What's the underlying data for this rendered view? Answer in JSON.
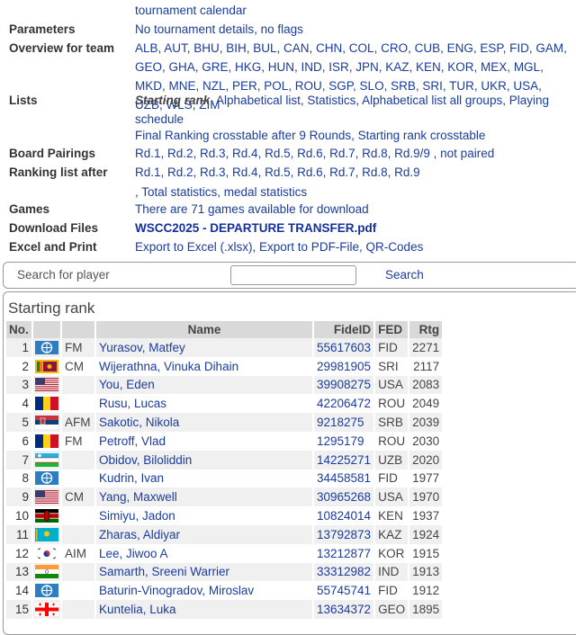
{
  "top": {
    "cut_link_text": "tournament calendar"
  },
  "info": [
    {
      "label": "Parameters",
      "value": "No tournament details, no flags"
    },
    {
      "label": "Overview for team",
      "value": "ALB, AUT, BHU, BIH, BUL, CAN, CHN, COL, CRO, CUB, ENG, ESP, FID, GAM, GEO, GHA, GRE, HKG, HUN, IND, ISR, JPN, KAZ, KEN, KOR, MEX, MGL, MKD, MNE, NZL, PER, POL, ROU, SGP, SLO, SRB, SRI, TUR, UKR, USA, UZB, WLS, ZIM"
    },
    {
      "label": "Lists",
      "value_italic": "Starting rank",
      "value": ", Alphabetical list, Statistics, Alphabetical list all groups, Playing schedule",
      "value2": "Final Ranking crosstable after 9 Rounds, Starting rank crosstable"
    },
    {
      "label": "Board Pairings",
      "value": "Rd.1, Rd.2, Rd.3, Rd.4, Rd.5, Rd.6, Rd.7, Rd.8, Rd.9/9 , not paired"
    },
    {
      "label": "Ranking list after",
      "value": "Rd.1, Rd.2, Rd.3, Rd.4, Rd.5, Rd.6, Rd.7, Rd.8, Rd.9",
      "value2": ", Total statistics, medal statistics"
    },
    {
      "label": "Games",
      "value": "There are 71 games available for download"
    },
    {
      "label": "Download Files",
      "value": "WSCC2025 - DEPARTURE TRANSFER.pdf"
    },
    {
      "label": "Excel and Print",
      "value": "Export to Excel (.xlsx), Export to PDF-File, QR-Codes"
    }
  ],
  "search": {
    "label": "Search for player",
    "placeholder": "",
    "button": "Search"
  },
  "starting_rank": {
    "title": "Starting rank",
    "columns": [
      "No.",
      "",
      "",
      "Name",
      "FideID",
      "FED",
      "Rtg"
    ],
    "rows": [
      {
        "no": "1",
        "flag": "fide",
        "title": "FM",
        "name": "Yurasov, Matfey",
        "fide": "55617603",
        "fed": "FID",
        "rtg": "2271"
      },
      {
        "no": "2",
        "flag": "sri",
        "title": "CM",
        "name": "Wijerathna, Vinuka Dihain",
        "fide": "29981905",
        "fed": "SRI",
        "rtg": "2117"
      },
      {
        "no": "3",
        "flag": "usa",
        "title": "",
        "name": "You, Eden",
        "fide": "39908275",
        "fed": "USA",
        "rtg": "2083"
      },
      {
        "no": "4",
        "flag": "rou",
        "title": "",
        "name": "Rusu, Lucas",
        "fide": "42206472",
        "fed": "ROU",
        "rtg": "2049"
      },
      {
        "no": "5",
        "flag": "srb",
        "title": "AFM",
        "name": "Sakotic, Nikola",
        "fide": "9218275",
        "fed": "SRB",
        "rtg": "2039"
      },
      {
        "no": "6",
        "flag": "rou",
        "title": "FM",
        "name": "Petroff, Vlad",
        "fide": "1295179",
        "fed": "ROU",
        "rtg": "2030"
      },
      {
        "no": "7",
        "flag": "uzb",
        "title": "",
        "name": "Obidov, Biloliddin",
        "fide": "14225271",
        "fed": "UZB",
        "rtg": "2020"
      },
      {
        "no": "8",
        "flag": "fide",
        "title": "",
        "name": "Kudrin, Ivan",
        "fide": "34458581",
        "fed": "FID",
        "rtg": "1977"
      },
      {
        "no": "9",
        "flag": "usa",
        "title": "CM",
        "name": "Yang, Maxwell",
        "fide": "30965268",
        "fed": "USA",
        "rtg": "1970"
      },
      {
        "no": "10",
        "flag": "ken",
        "title": "",
        "name": "Simiyu, Jadon",
        "fide": "10824014",
        "fed": "KEN",
        "rtg": "1937"
      },
      {
        "no": "11",
        "flag": "kaz",
        "title": "",
        "name": "Zharas, Aldiyar",
        "fide": "13792873",
        "fed": "KAZ",
        "rtg": "1924"
      },
      {
        "no": "12",
        "flag": "kor",
        "title": "AIM",
        "name": "Lee, Jiwoo A",
        "fide": "13212877",
        "fed": "KOR",
        "rtg": "1915"
      },
      {
        "no": "13",
        "flag": "ind",
        "title": "",
        "name": "Samarth, Sreeni Warrier",
        "fide": "33312982",
        "fed": "IND",
        "rtg": "1913"
      },
      {
        "no": "14",
        "flag": "fide",
        "title": "",
        "name": "Baturin-Vinogradov, Miroslav",
        "fide": "55745741",
        "fed": "FID",
        "rtg": "1912"
      },
      {
        "no": "15",
        "flag": "geo",
        "title": "",
        "name": "Kuntelia, Luka",
        "fide": "13634372",
        "fed": "GEO",
        "rtg": "1895"
      }
    ]
  },
  "colors": {
    "link": "#1a3c9c",
    "header_bg": "#d9d9d9",
    "row_alt": "#f0f0f0",
    "highlight": "#f5e07a"
  }
}
